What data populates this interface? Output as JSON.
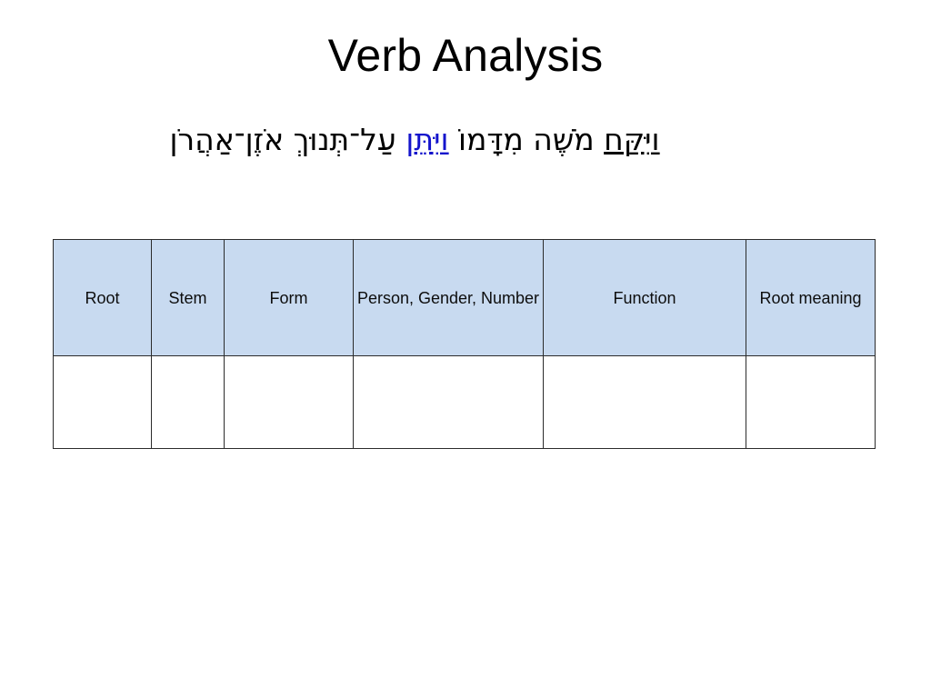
{
  "slide": {
    "title": "Verb Analysis",
    "background_color": "#ffffff",
    "title_color": "#000000"
  },
  "verse": {
    "full_text": "וַיִּקַּח מֹשֶׁה מִדָּמוֹ וַיִּתֵּן עַל־תְּנוּךְ אֹזֶן־אַהֲרֹן",
    "direction": "rtl",
    "highlight_color": "#1414cc",
    "segments": [
      {
        "text": "וַיִּקַּח",
        "style": "underlined",
        "color": "#000000"
      },
      {
        "text": " ",
        "style": "plain",
        "color": "#000000"
      },
      {
        "text": "מֹשֶׁה מִדָּמוֹ",
        "style": "plain",
        "color": "#000000"
      },
      {
        "text": " ",
        "style": "plain",
        "color": "#000000"
      },
      {
        "text": "וַיִּתֵּן",
        "style": "highlight",
        "color": "#1414cc"
      },
      {
        "text": " ",
        "style": "plain",
        "color": "#000000"
      },
      {
        "text": "עַל־תְּנוּךְ אֹזֶן־אַהֲרֹן",
        "style": "plain",
        "color": "#000000"
      }
    ]
  },
  "table": {
    "header_fill": "#c8daf0",
    "border_color": "#2b2b2b",
    "columns": [
      {
        "key": "root",
        "label": "Root"
      },
      {
        "key": "stem",
        "label": "Stem"
      },
      {
        "key": "form",
        "label": "Form"
      },
      {
        "key": "pgn",
        "label": "Person, Gender, Number"
      },
      {
        "key": "function",
        "label": "Function"
      },
      {
        "key": "meaning",
        "label": "Root meaning"
      }
    ],
    "rows": [
      {
        "root": "",
        "stem": "",
        "form": "",
        "pgn": "",
        "function": "",
        "meaning": ""
      }
    ]
  }
}
